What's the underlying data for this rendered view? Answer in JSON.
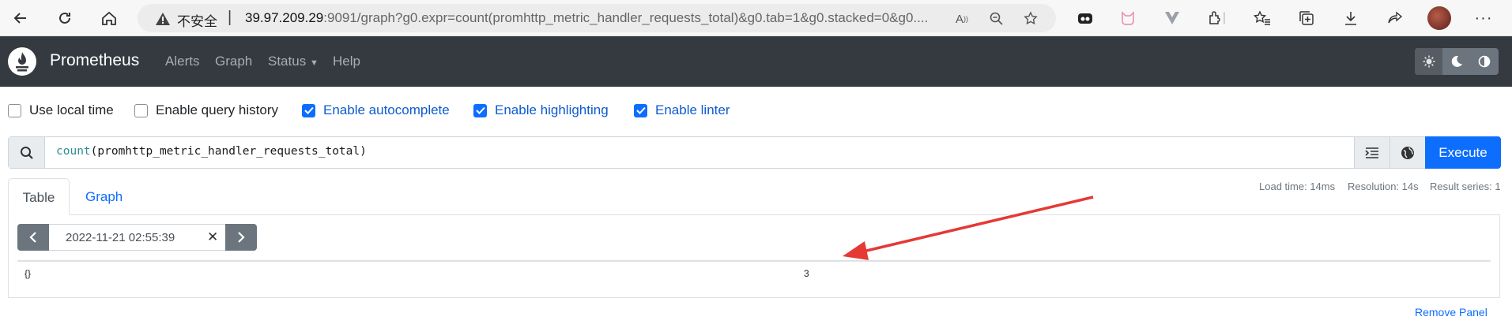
{
  "browser": {
    "insecure_label": "不安全",
    "url_host": "39.97.209.29",
    "url_rest": ":9091/graph?g0.expr=count(promhttp_metric_handler_requests_total)&g0.tab=1&g0.stacked=0&g0....",
    "icons": [
      "back-icon",
      "refresh-icon",
      "home-icon",
      "warning-icon",
      "read-aloud-icon",
      "zoom-icon",
      "favorite-add-icon",
      "extension-icon",
      "cat-extension-icon",
      "vue-extension-icon",
      "puzzle-icon",
      "favorites-icon",
      "collections-icon",
      "downloads-icon",
      "share-icon",
      "profile-avatar",
      "more-icon"
    ]
  },
  "navbar": {
    "brand": "Prometheus",
    "links": [
      "Alerts",
      "Graph",
      "Status",
      "Help"
    ],
    "theme_buttons": [
      "light-theme-icon",
      "dark-theme-icon",
      "auto-theme-icon"
    ]
  },
  "options": [
    {
      "label": "Use local time",
      "checked": false
    },
    {
      "label": "Enable query history",
      "checked": false
    },
    {
      "label": "Enable autocomplete",
      "checked": true
    },
    {
      "label": "Enable highlighting",
      "checked": true
    },
    {
      "label": "Enable linter",
      "checked": true
    }
  ],
  "query": {
    "fn": "count",
    "args": "(promhttp_metric_handler_requests_total)",
    "execute_label": "Execute"
  },
  "tabs": {
    "table": "Table",
    "graph": "Graph"
  },
  "stats": {
    "load_time": "Load time: 14ms",
    "resolution": "Resolution: 14s",
    "result_series": "Result series: 1"
  },
  "panel": {
    "eval_time": "2022-11-21 02:55:39",
    "clear_symbol": "✕",
    "rows": [
      {
        "labels": "{}",
        "value": "3"
      }
    ],
    "remove_label": "Remove Panel"
  },
  "colors": {
    "navbar": "#343a40",
    "primary": "#0d6efd",
    "annotation_arrow": "#e53935"
  }
}
